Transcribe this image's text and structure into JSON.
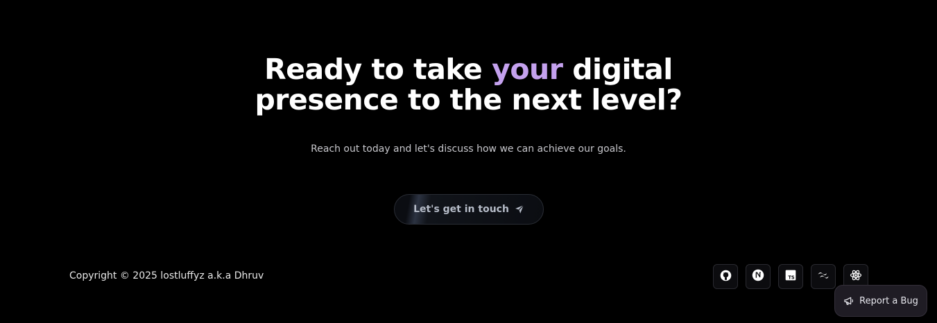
{
  "hero": {
    "headline_before": "Ready to take ",
    "headline_highlight": "your",
    "headline_after_line1": " digital",
    "headline_line2": "presence to the next level?",
    "subtext": "Reach out today and let's discuss how we can achieve our goals.",
    "cta_label": "Let's get in touch",
    "cta_icon": "send-icon"
  },
  "footer": {
    "copyright": "Copyright © 2025 lostluffyz a.k.a Dhruv",
    "tech_icons": [
      "github-icon",
      "nextjs-icon",
      "typescript-icon",
      "tailwind-icon",
      "react-icon"
    ],
    "typescript_glyph": "TS"
  },
  "report_bug": {
    "label": "Report a Bug",
    "icon": "megaphone-icon"
  },
  "colors": {
    "background": "#000000",
    "accent": "#c4a1ee"
  }
}
